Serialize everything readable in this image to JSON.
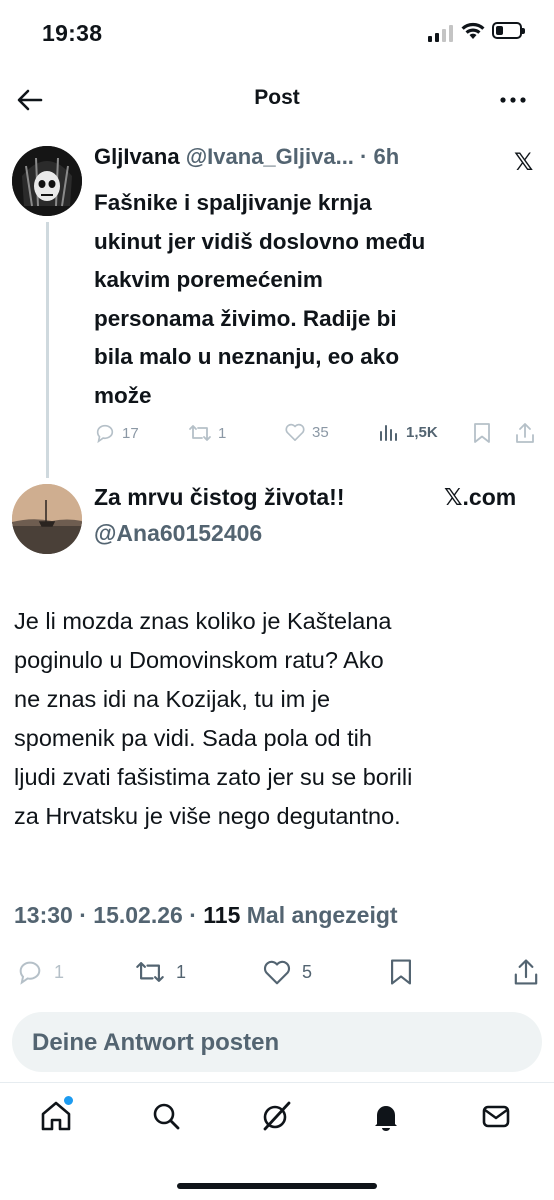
{
  "status_bar": {
    "time": "19:38"
  },
  "header": {
    "title": "Post"
  },
  "quoted_post": {
    "author_name": "GljIvana",
    "author_handle": "@Ivana_Gljiva...",
    "age": "· 6h",
    "x_logo": "𝕏",
    "text": "Fašnike i spaljivanje krnja\nukinut jer vidiš doslovno među\nkakvim poremećenim\npersonama živimo. Radije bi\nbila malo u neznanju, eo ako\nmože",
    "replies": "17",
    "reposts": "1",
    "likes": "35",
    "views": "1,5K"
  },
  "post": {
    "author_name": "Za mrvu čistog života!!",
    "source": "𝕏.com",
    "author_handle": "@Ana60152406",
    "text": "Je li mozda znas koliko je Kaštelana\npoginulo u Domovinskom ratu? Ako\nne znas idi na Kozijak, tu im je\nspomenik pa vidi. Sada pola od tih\nljudi zvati fašistima zato jer su se borili\nza Hrvatsku je više nego degutantno.",
    "time": "13:30",
    "date": "15.02.26",
    "views_count": "115",
    "views_label": "Mal angezeigt",
    "replies": "1",
    "reposts": "1",
    "likes": "5"
  },
  "reply_box": {
    "placeholder": "Deine Antwort posten"
  },
  "tab_bar": {
    "items": [
      "home-icon",
      "search-icon",
      "grok-icon",
      "notifications-icon",
      "messages-icon"
    ],
    "notification_dot_color": "#1d9bf0"
  },
  "colors": {
    "text": "#0f1419",
    "secondary": "#536471",
    "accent": "#1d9bf0"
  }
}
